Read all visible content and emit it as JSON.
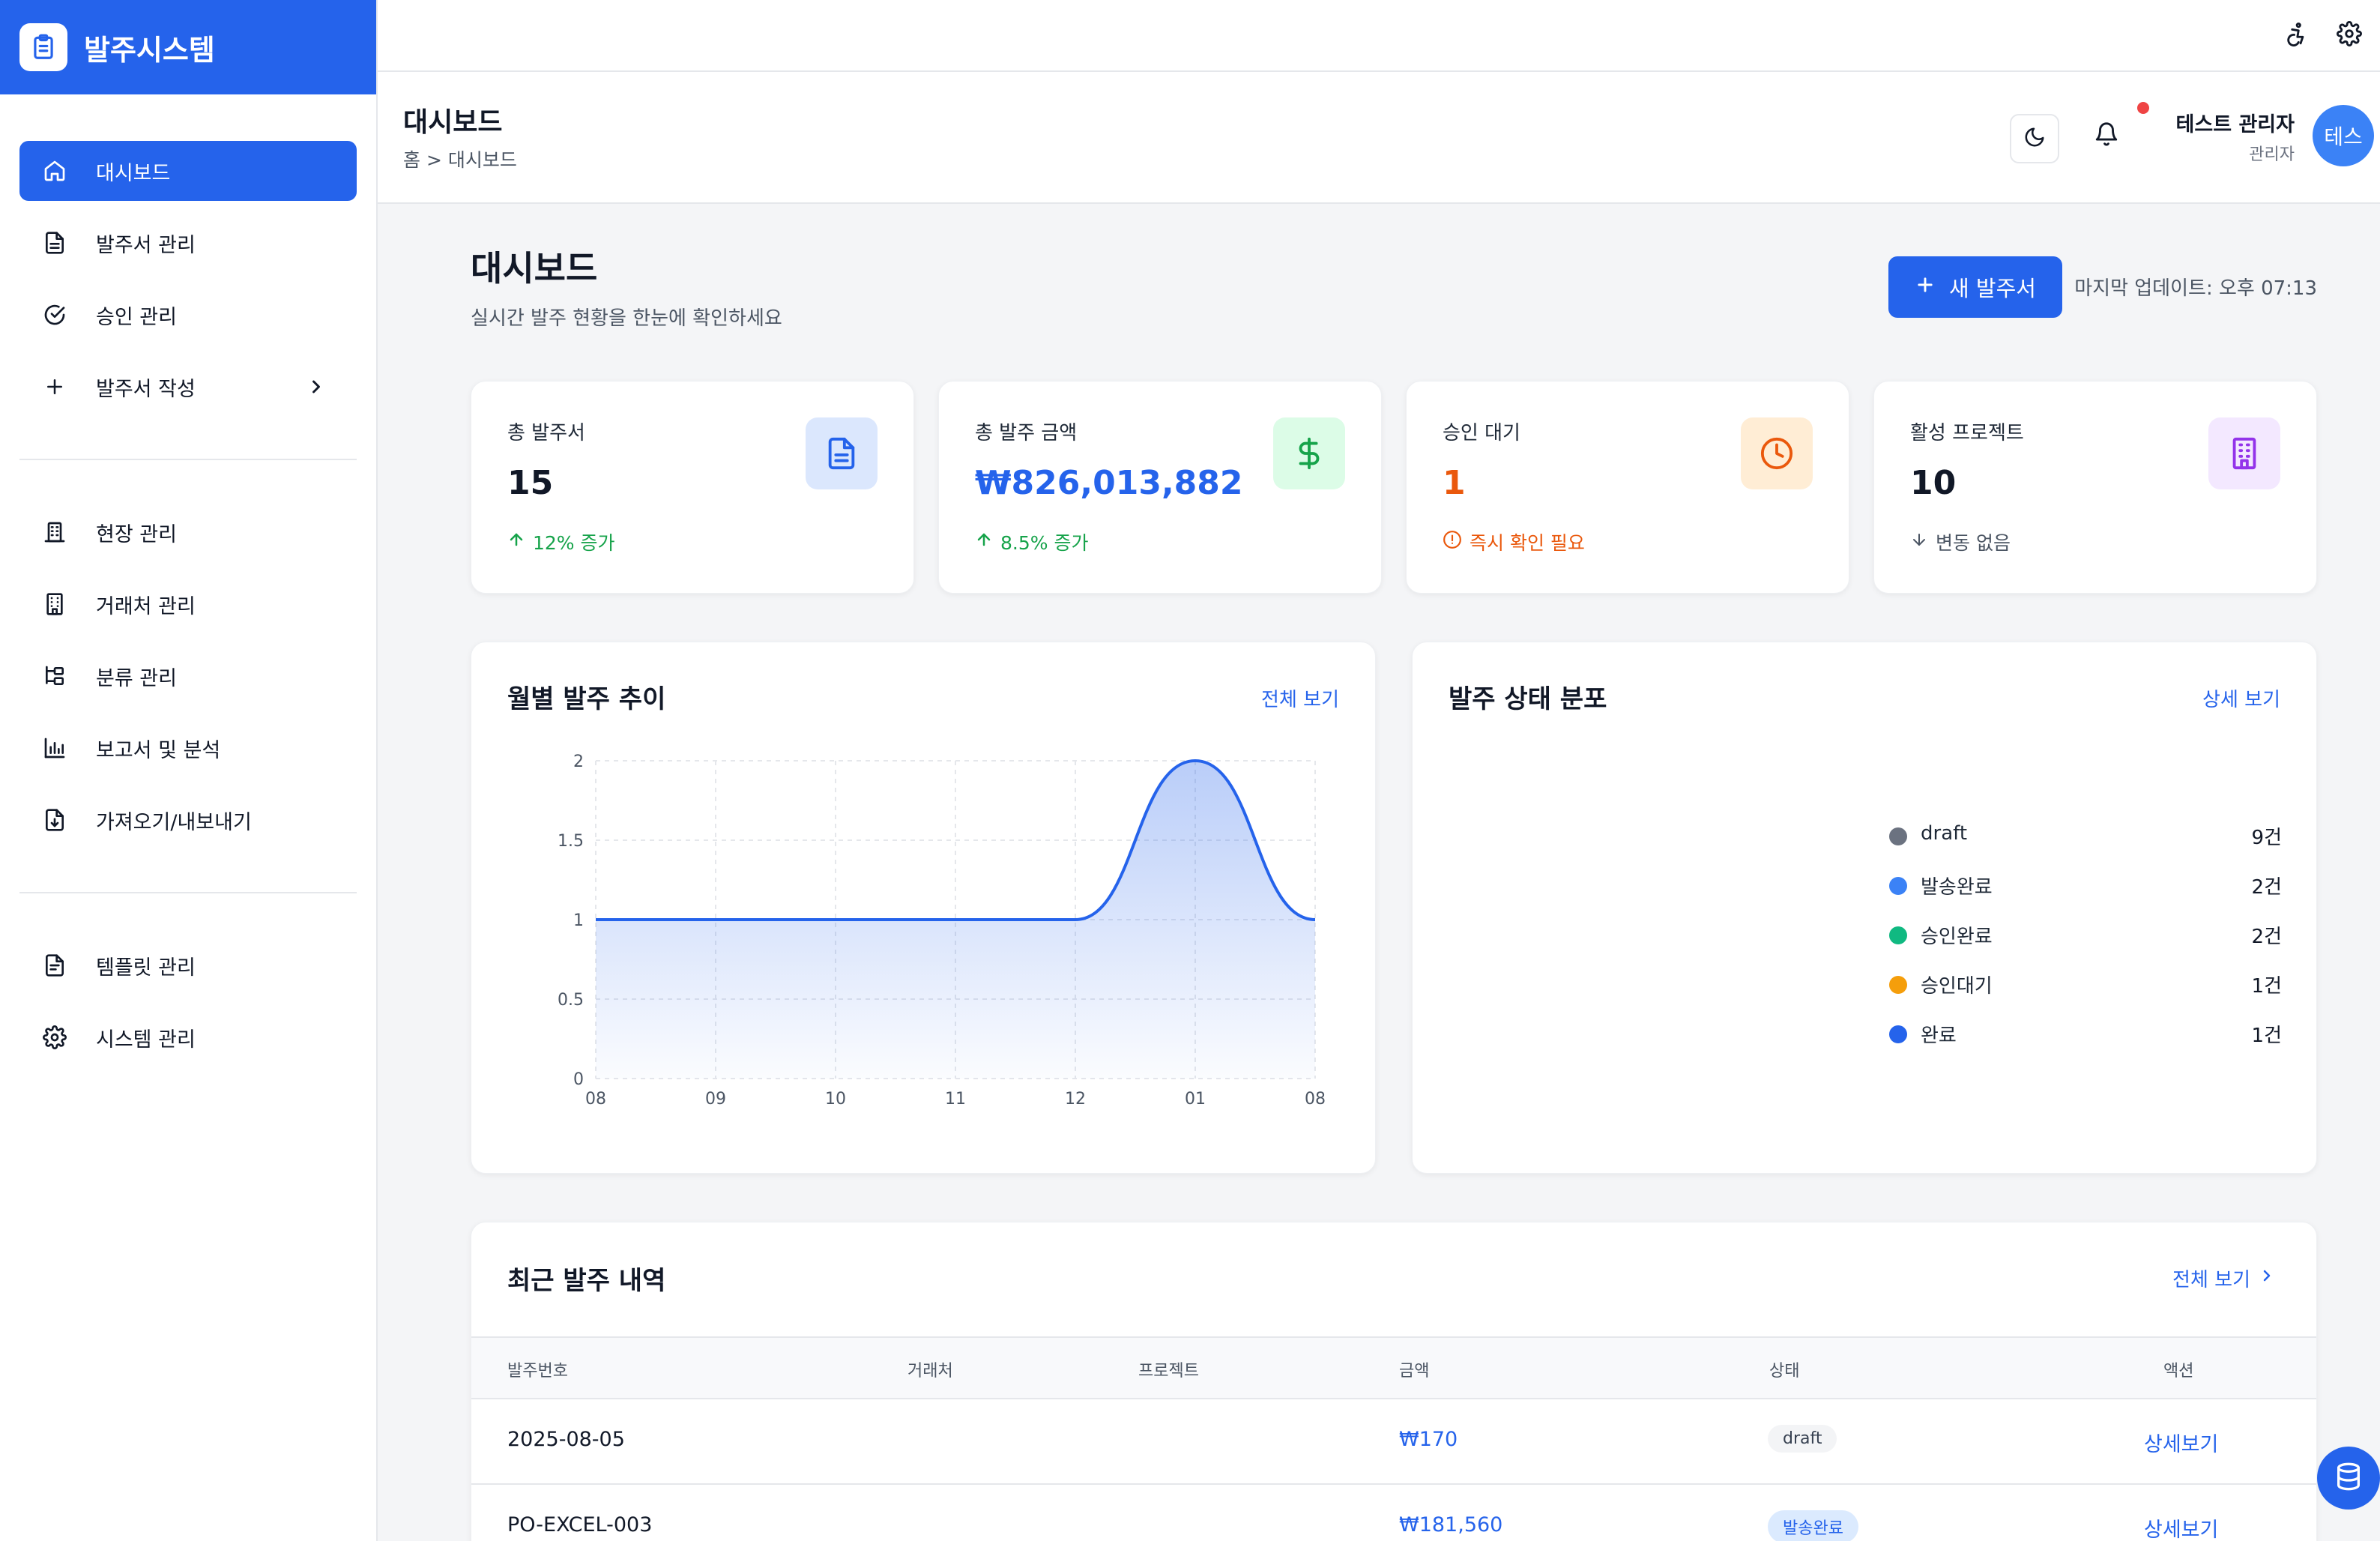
{
  "brand": {
    "title": "발주시스템"
  },
  "sidebar": {
    "items": [
      {
        "label": "대시보드"
      },
      {
        "label": "발주서 관리"
      },
      {
        "label": "승인 관리"
      },
      {
        "label": "발주서 작성"
      },
      {
        "label": "현장 관리"
      },
      {
        "label": "거래처 관리"
      },
      {
        "label": "분류 관리"
      },
      {
        "label": "보고서 및 분석"
      },
      {
        "label": "가져오기/내보내기"
      },
      {
        "label": "템플릿 관리"
      },
      {
        "label": "시스템 관리"
      }
    ]
  },
  "header": {
    "title": "대시보드",
    "breadcrumb": "홈 > 대시보드",
    "user_name": "테스트 관리자",
    "user_role": "관리자",
    "avatar_text": "테스"
  },
  "main": {
    "title": "대시보드",
    "subtitle": "실시간 발주 현황을 한눈에 확인하세요",
    "new_button": "새 발주서",
    "last_update": "마지막 업데이트: 오후 07:13"
  },
  "stats": [
    {
      "label": "총 발주서",
      "value": "15",
      "trend": "12% 증가",
      "color": "#111827",
      "trend_color": "#16a34a",
      "icon": "document-icon",
      "icon_bg": "#dbe7fd",
      "icon_color": "#2563eb"
    },
    {
      "label": "총 발주 금액",
      "value": "₩826,013,882",
      "trend": "8.5% 증가",
      "color": "#2563eb",
      "trend_color": "#16a34a",
      "icon": "dollar-icon",
      "icon_bg": "#dcfce7",
      "icon_color": "#16a34a"
    },
    {
      "label": "승인 대기",
      "value": "1",
      "trend": "즉시 확인 필요",
      "color": "#ea580c",
      "trend_color": "#ea580c",
      "icon": "clock-icon",
      "icon_bg": "#ffedd5",
      "icon_color": "#ea580c"
    },
    {
      "label": "활성 프로젝트",
      "value": "10",
      "trend": "변동 없음",
      "color": "#111827",
      "trend_color": "#4b5563",
      "icon": "building-icon",
      "icon_bg": "#f3e8ff",
      "icon_color": "#9333ea"
    }
  ],
  "monthly": {
    "title": "월별 발주 추이",
    "link": "전체 보기"
  },
  "chart_data": {
    "type": "area",
    "title": "월별 발주 추이",
    "categories": [
      "08",
      "09",
      "10",
      "11",
      "12",
      "01",
      "08"
    ],
    "values": [
      1,
      1,
      1,
      1,
      1,
      2,
      1
    ],
    "ylim": [
      0,
      2
    ],
    "yticks": [
      "0",
      "0.5",
      "1",
      "1.5",
      "2"
    ],
    "grid": true,
    "color": "#2563eb"
  },
  "status": {
    "title": "발주 상태 분포",
    "link": "상세 보기",
    "items": [
      {
        "name": "draft",
        "count": "9건",
        "color": "#6b7280"
      },
      {
        "name": "발송완료",
        "count": "2건",
        "color": "#3b82f6"
      },
      {
        "name": "승인완료",
        "count": "2건",
        "color": "#10b981"
      },
      {
        "name": "승인대기",
        "count": "1건",
        "color": "#f59e0b"
      },
      {
        "name": "완료",
        "count": "1건",
        "color": "#2563eb"
      }
    ]
  },
  "recent": {
    "title": "최근 발주 내역",
    "link": "전체 보기",
    "columns": [
      "발주번호",
      "거래처",
      "프로젝트",
      "금액",
      "상태",
      "액션"
    ],
    "rows": [
      {
        "number": "2025-08-05",
        "vendor": "",
        "project": "",
        "amount": "₩170",
        "status": "draft",
        "status_bg": "#f3f4f6",
        "status_color": "#374151",
        "action": "상세보기"
      },
      {
        "number": "PO-EXCEL-003",
        "vendor": "",
        "project": "",
        "amount": "₩181,560",
        "status": "발송완료",
        "status_bg": "#dbeafe",
        "status_color": "#2563eb",
        "action": "상세보기"
      }
    ]
  }
}
